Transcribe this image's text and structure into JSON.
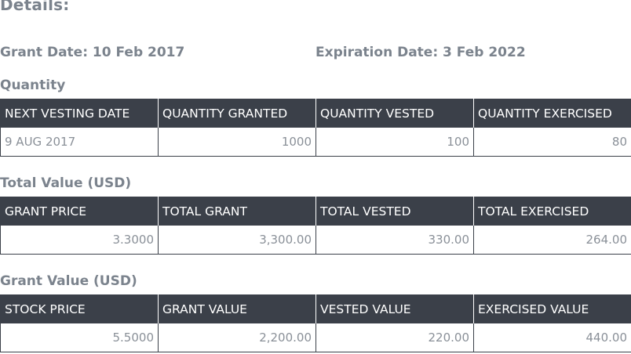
{
  "details": {
    "heading": "Details:",
    "grant_date": "Grant Date: 10 Feb 2017",
    "expiration_date": "Expiration Date: 3 Feb 2022"
  },
  "quantity": {
    "title": "Quantity",
    "headers": [
      "NEXT VESTING DATE",
      "QUANTITY GRANTED",
      "QUANTITY VESTED",
      "QUANTITY EXERCISED"
    ],
    "row": [
      "9 AUG 2017",
      "1000",
      "100",
      "80"
    ]
  },
  "total_value": {
    "title": "Total Value (USD)",
    "headers": [
      "GRANT PRICE",
      "TOTAL GRANT",
      "TOTAL VESTED",
      "TOTAL EXERCISED"
    ],
    "row": [
      "3.3000",
      "3,300.00",
      "330.00",
      "264.00"
    ]
  },
  "grant_value": {
    "title": "Grant Value (USD)",
    "headers": [
      "STOCK PRICE",
      "GRANT VALUE",
      "VESTED VALUE",
      "EXERCISED VALUE"
    ],
    "row": [
      "5.5000",
      "2,200.00",
      "220.00",
      "440.00"
    ]
  },
  "colors": {
    "header_bg": "#3b4049",
    "label_text": "#7b838d",
    "cell_text": "#8a9098"
  }
}
